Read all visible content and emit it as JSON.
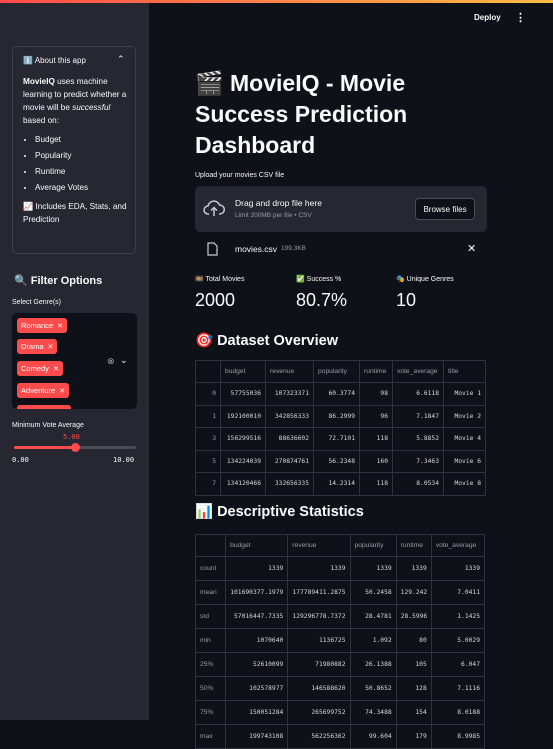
{
  "header": {
    "deploy_label": "Deploy",
    "menu_icon": "kebab-menu-icon"
  },
  "sidebar": {
    "about": {
      "title": "ℹ️ About this app",
      "intro_brand": "MovieIQ",
      "intro_text": " uses machine learning to predict whether a movie will be ",
      "intro_em": "successful",
      "intro_tail": " based on:",
      "bullets": [
        "Budget",
        "Popularity",
        "Runtime",
        "Average Votes"
      ],
      "footer": "📈 Includes EDA, Stats, and Prediction"
    },
    "filter_title": "🔍 Filter Options",
    "genre_label": "Select Genre(s)",
    "genres": [
      "Romance",
      "Drama",
      "Comedy",
      "Adventure"
    ],
    "min_vote_label": "Minimum Vote Average",
    "slider": {
      "value": "5.00",
      "min": "0.00",
      "max": "10.00",
      "fraction": 0.5
    }
  },
  "main": {
    "title": "🎬 MovieIQ - Movie Success Prediction Dashboard",
    "upload_label": "Upload your movies CSV file",
    "dropzone": {
      "title": "Drag and drop file here",
      "subtitle": "Limit 200MB per file • CSV",
      "button": "Browse files"
    },
    "file": {
      "name": "movies.csv",
      "size": "199.3KB"
    },
    "metrics": [
      {
        "label": "🎞️ Total Movies",
        "value": "2000"
      },
      {
        "label": "✅ Success %",
        "value": "80.7%"
      },
      {
        "label": "🎭 Unique Genres",
        "value": "10"
      }
    ],
    "overview_title": "🎯 Dataset Overview",
    "overview": {
      "columns": [
        "",
        "budget",
        "revenue",
        "popularity",
        "runtime",
        "vote_average",
        "title"
      ],
      "rows": [
        [
          "0",
          "57755036",
          "107323371",
          "60.3774",
          "98",
          "6.6118",
          "Movie 1"
        ],
        [
          "1",
          "192100010",
          "342856333",
          "86.2999",
          "96",
          "7.1847",
          "Movie 2"
        ],
        [
          "3",
          "156299516",
          "88636602",
          "72.7101",
          "118",
          "5.8852",
          "Movie 4"
        ],
        [
          "5",
          "134224039",
          "270874761",
          "56.2348",
          "160",
          "7.3463",
          "Movie 6"
        ],
        [
          "7",
          "134120466",
          "332656335",
          "14.2314",
          "118",
          "8.0534",
          "Movie 8"
        ]
      ]
    },
    "stats_title": "📊 Descriptive Statistics",
    "stats": {
      "columns": [
        "",
        "budget",
        "revenue",
        "popularity",
        "runtime",
        "vote_average"
      ],
      "rows": [
        [
          "count",
          "1339",
          "1339",
          "1339",
          "1339",
          "1339"
        ],
        [
          "mean",
          "101690377.1979",
          "177789411.2875",
          "50.2458",
          "129.242",
          "7.0411"
        ],
        [
          "std",
          "57016447.7335",
          "129296778.7372",
          "28.4781",
          "28.5996",
          "1.1425"
        ],
        [
          "min",
          "1070640",
          "1136725",
          "1.092",
          "80",
          "5.0029"
        ],
        [
          "25%",
          "52610099",
          "71980882",
          "26.1388",
          "105",
          "6.047"
        ],
        [
          "50%",
          "102578977",
          "146588620",
          "50.8652",
          "128",
          "7.1116"
        ],
        [
          "75%",
          "150051284",
          "265699752",
          "74.3488",
          "154",
          "8.0188"
        ],
        [
          "max",
          "199743108",
          "562256362",
          "99.604",
          "179",
          "8.9985"
        ]
      ]
    }
  }
}
